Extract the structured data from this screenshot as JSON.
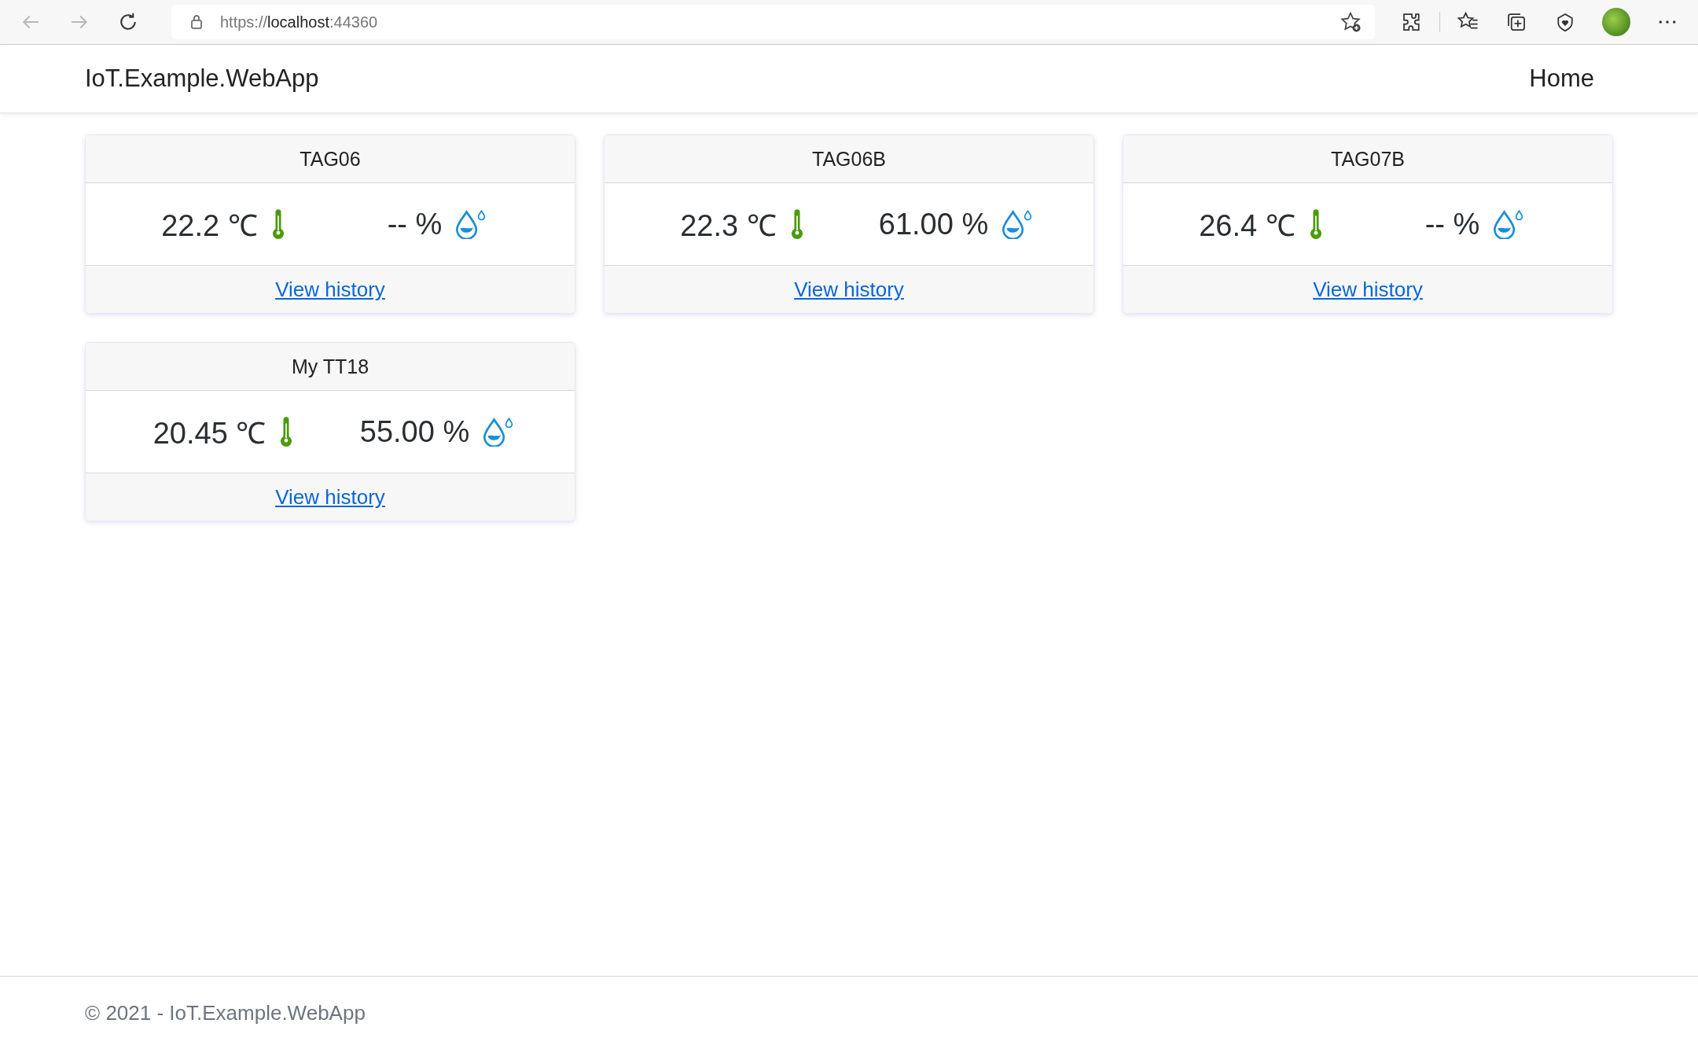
{
  "browser": {
    "url_scheme": "https://",
    "url_host": "localhost",
    "url_port": ":44360"
  },
  "navbar": {
    "brand": "IoT.Example.WebApp",
    "links": [
      {
        "label": "Home"
      }
    ]
  },
  "cards": [
    {
      "title": "TAG06",
      "temperature": "22.2 ℃",
      "humidity": "-- %",
      "link": "View history"
    },
    {
      "title": "TAG06B",
      "temperature": "22.3 ℃",
      "humidity": "61.00 %",
      "link": "View history"
    },
    {
      "title": "TAG07B",
      "temperature": "26.4 ℃",
      "humidity": "-- %",
      "link": "View history"
    },
    {
      "title": "My TT18",
      "temperature": "20.45 ℃",
      "humidity": "55.00 %",
      "link": "View history"
    }
  ],
  "footer": "© 2021 - IoT.Example.WebApp"
}
